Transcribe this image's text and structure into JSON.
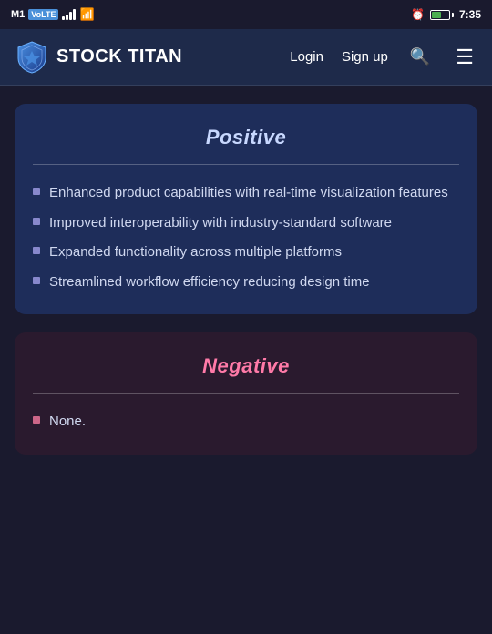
{
  "statusBar": {
    "carrier": "M1",
    "carrierBadge": "VoLTE",
    "time": "7:35",
    "alarmIcon": "alarm-icon",
    "batteryIcon": "battery-icon",
    "signalIcon": "signal-icon",
    "wifiIcon": "wifi-icon"
  },
  "navbar": {
    "logoText": "STOCK TITAN",
    "loginLabel": "Login",
    "signupLabel": "Sign up",
    "searchIcon": "search-icon",
    "menuIcon": "menu-icon"
  },
  "positiveCard": {
    "title": "Positive",
    "items": [
      "Enhanced product capabilities with real-time visualization features",
      "Improved interoperability with industry-standard software",
      "Expanded functionality across multiple platforms",
      "Streamlined workflow efficiency reducing design time"
    ]
  },
  "negativeCard": {
    "title": "Negative",
    "items": [
      "None."
    ]
  }
}
